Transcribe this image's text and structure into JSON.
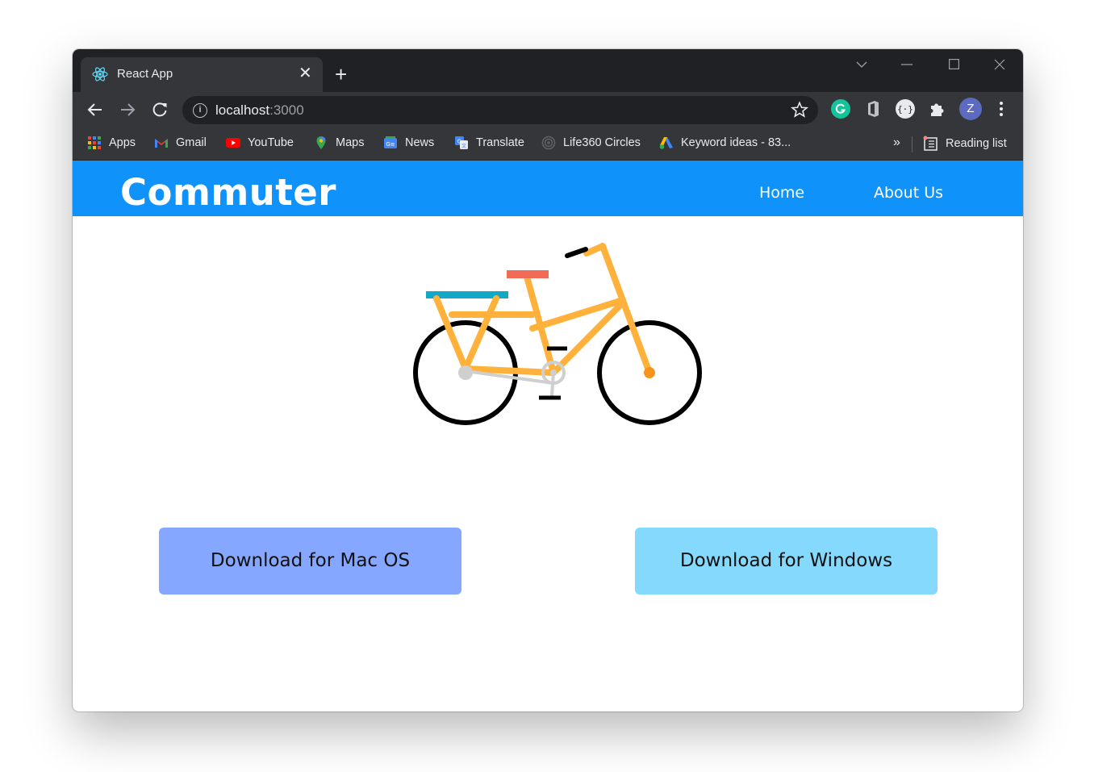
{
  "browser": {
    "tab_title": "React App",
    "tab_close": "✕",
    "new_tab": "+",
    "url_host": "localhost",
    "url_port": ":3000",
    "profile_initial": "Z",
    "bookmarks": [
      {
        "label": "Apps",
        "icon": "apps-grid-icon"
      },
      {
        "label": "Gmail",
        "icon": "gmail-icon"
      },
      {
        "label": "YouTube",
        "icon": "youtube-icon"
      },
      {
        "label": "Maps",
        "icon": "maps-icon"
      },
      {
        "label": "News",
        "icon": "news-icon"
      },
      {
        "label": "Translate",
        "icon": "translate-icon"
      },
      {
        "label": "Life360 Circles",
        "icon": "life360-icon"
      },
      {
        "label": "Keyword ideas - 83...",
        "icon": "google-ads-icon"
      }
    ],
    "more_bookmarks": "»",
    "reading_list": "Reading list"
  },
  "app": {
    "brand": "Commuter",
    "nav": {
      "home": "Home",
      "about": "About Us"
    },
    "download_mac": "Download for Mac OS",
    "download_windows": "Download for Windows",
    "colors": {
      "navbar": "#0f93fb",
      "mac_button": "#85a7ff",
      "windows_button": "#85d9fd",
      "bike_frame": "#ffb13b",
      "bike_seat": "#f26b57",
      "bike_rack": "#12a9c6"
    }
  }
}
